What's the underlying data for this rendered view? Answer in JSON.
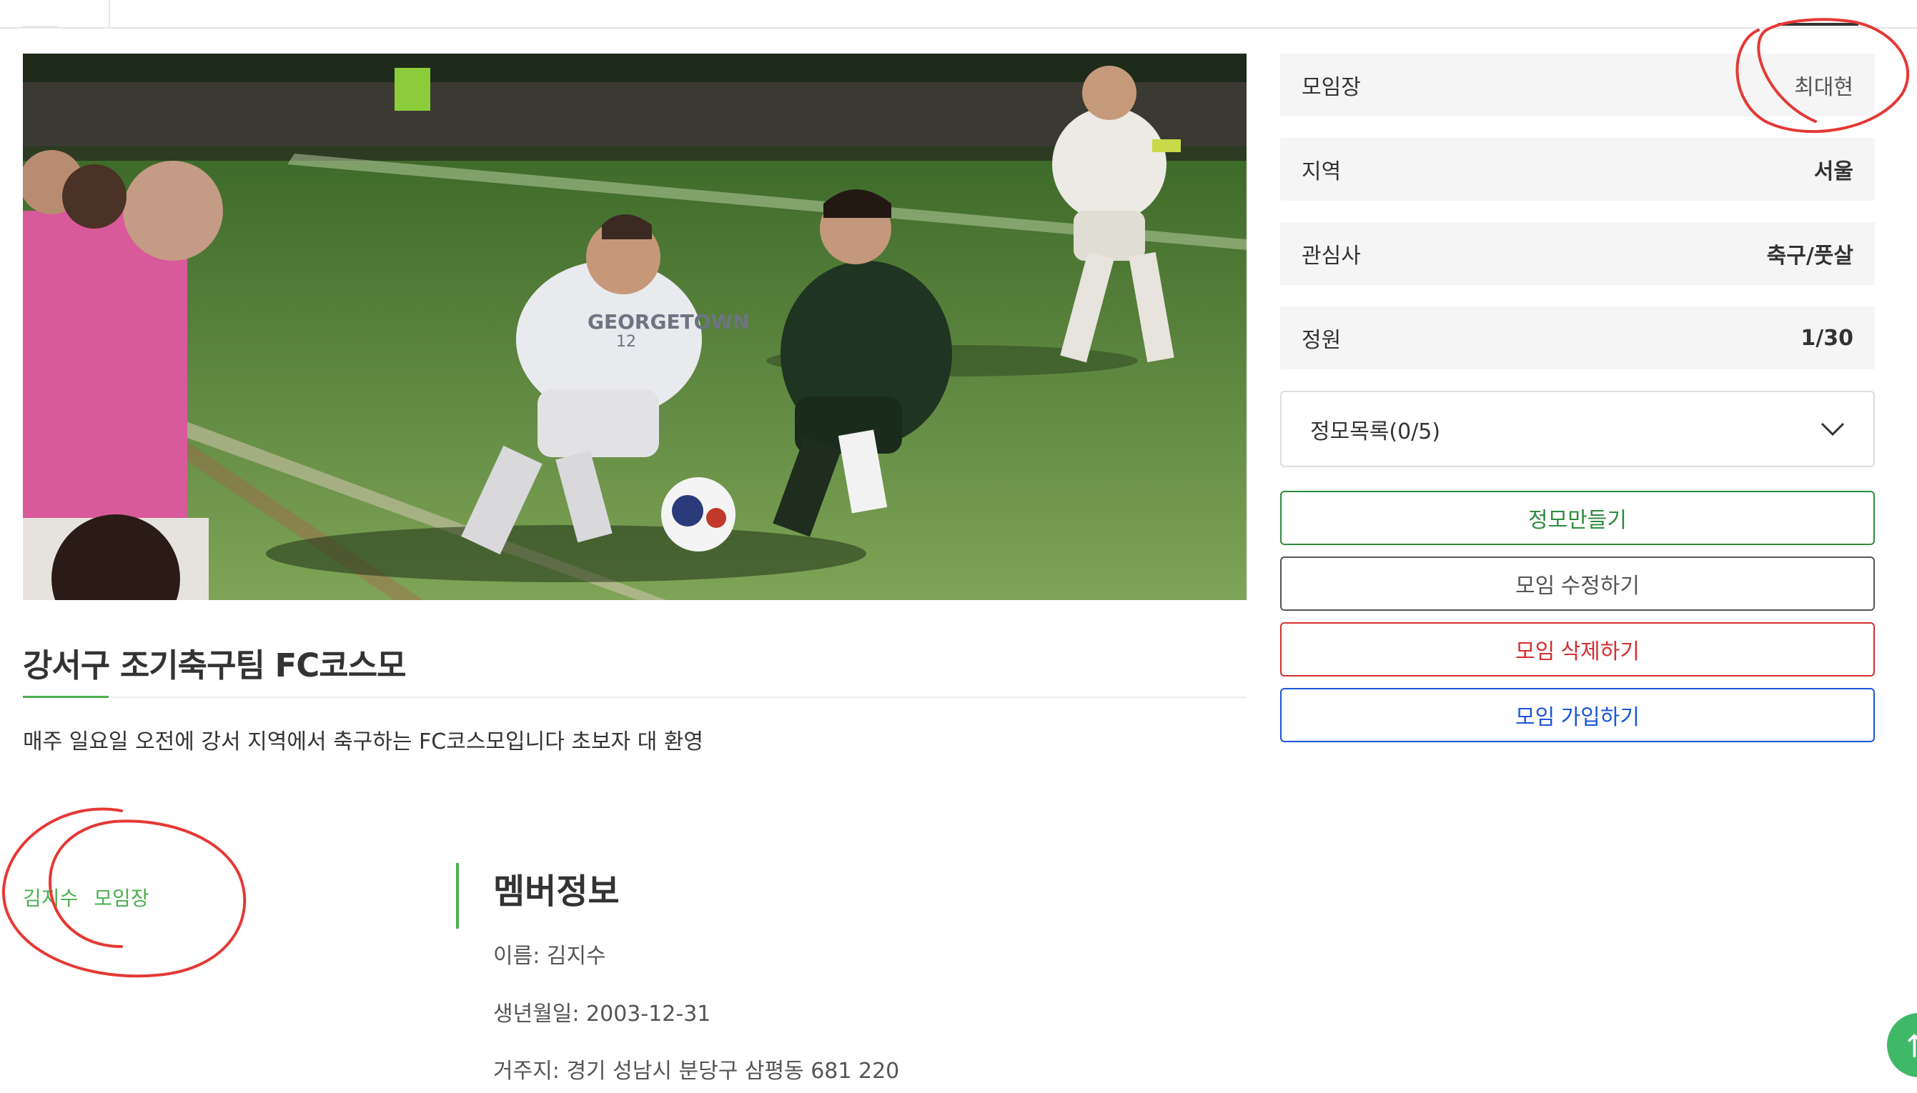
{
  "group": {
    "title": "강서구 조기축구팀 FC코스모",
    "description": "매주 일요일 오전에 강서 지역에서 축구하는 FC코스모입니다 초보자 대 환영"
  },
  "info": [
    {
      "label": "모임장",
      "value": "최대현"
    },
    {
      "label": "지역",
      "value": "서울"
    },
    {
      "label": "관심사",
      "value": "축구/풋살"
    },
    {
      "label": "정원",
      "value": "1/30"
    }
  ],
  "meetings_dropdown": {
    "label": "정모목록(0/5)"
  },
  "actions": {
    "create_meeting": "정모만들기",
    "edit_group": "모임 수정하기",
    "delete_group": "모임 삭제하기",
    "join_group": "모임 가입하기"
  },
  "member_list": [
    {
      "name": "김지수",
      "role": "모임장"
    }
  ],
  "member_info": {
    "heading": "멤버정보",
    "name_line": "이름: 김지수",
    "birth_line": "생년월일: 2003-12-31",
    "address_line": "거주지: 경기 성남시 분당구 삼평동 681 220"
  },
  "hero_image": {
    "icon": "soccer-match-photo"
  },
  "colors": {
    "accent_green": "#4caf50",
    "btn_green": "#2e8b3e",
    "btn_red": "#d32f2f",
    "btn_blue": "#1a56d6",
    "annotation_red": "#e53935"
  }
}
